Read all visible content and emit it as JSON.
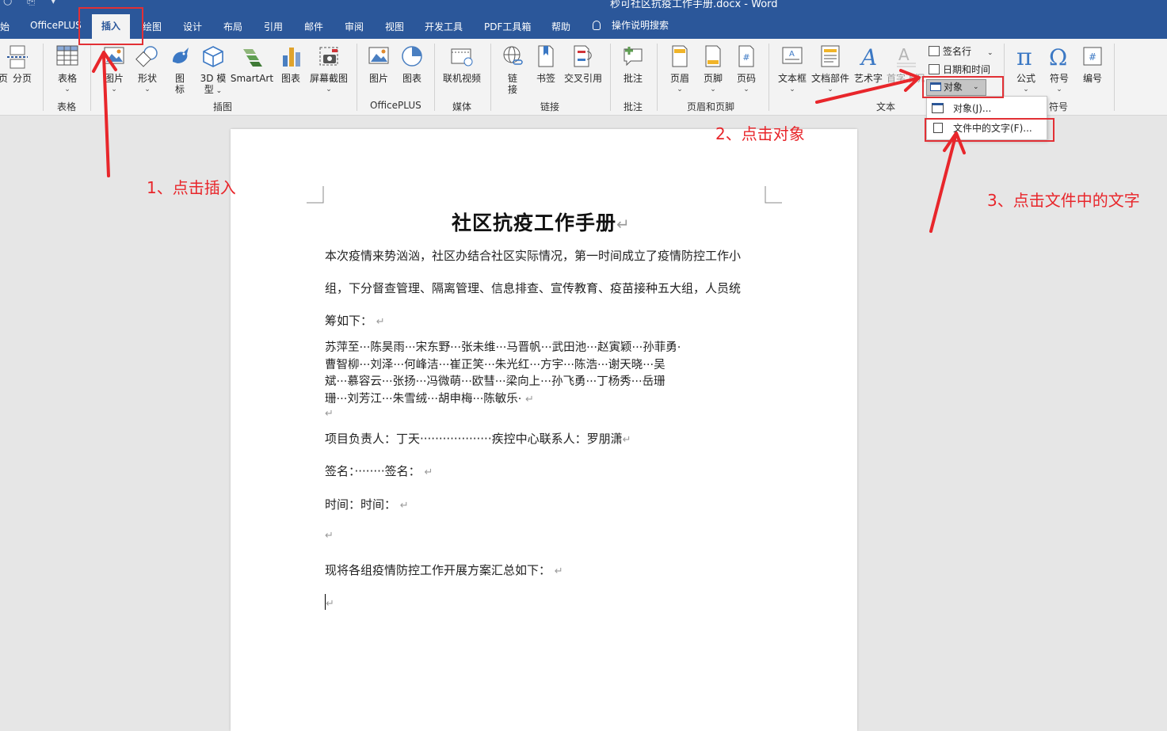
{
  "window": {
    "title": "秒可社区抗疫工作手册.docx  -  Word",
    "qa_icons": [
      "save-icon",
      "customize-quick-access-icon"
    ]
  },
  "tabs": [
    {
      "label": "始",
      "active": false
    },
    {
      "label": "OfficePLUS",
      "active": false
    },
    {
      "label": "插入",
      "active": true
    },
    {
      "label": "绘图",
      "active": false
    },
    {
      "label": "设计",
      "active": false
    },
    {
      "label": "布局",
      "active": false
    },
    {
      "label": "引用",
      "active": false
    },
    {
      "label": "邮件",
      "active": false
    },
    {
      "label": "审阅",
      "active": false
    },
    {
      "label": "视图",
      "active": false
    },
    {
      "label": "开发工具",
      "active": false
    },
    {
      "label": "PDF工具箱",
      "active": false
    },
    {
      "label": "帮助",
      "active": false
    }
  ],
  "tell_me": "操作说明搜索",
  "ribbon": {
    "buttons": {
      "page_break_prefix": "页",
      "page_break": "分页",
      "table": "表格",
      "picture": "图片",
      "shapes": "形状",
      "icons_l1": "图",
      "icons_l2": "标",
      "model3d_l1": "3D 模",
      "model3d_l2": "型",
      "smartart": "SmartArt",
      "chart": "图表",
      "screenshot": "屏幕截图",
      "op_picture": "图片",
      "op_chart": "图表",
      "online_video": "联机视频",
      "link_l1": "链",
      "link_l2": "接",
      "bookmark": "书签",
      "cross_ref": "交叉引用",
      "comment": "批注",
      "header": "页眉",
      "footer": "页脚",
      "page_number": "页码",
      "textbox": "文本框",
      "quick_parts": "文档部件",
      "wordart": "艺术字",
      "drop_cap": "首字下沉",
      "signature_line": "签名行",
      "date_time": "日期和时间",
      "object": "对象",
      "equation": "公式",
      "symbol": "符号",
      "number": "编号"
    },
    "groups": {
      "tables": "表格",
      "illustrations": "插图",
      "officeplus": "OfficePLUS",
      "media": "媒体",
      "links": "链接",
      "comments": "批注",
      "header_footer": "页眉和页脚",
      "text": "文本",
      "symbols": "符号"
    },
    "object_menu": {
      "item1": "对象(J)...",
      "item2": "文件中的文字(F)..."
    }
  },
  "document": {
    "title": "社区抗疫工作手册",
    "para1_l1": "本次疫情来势汹汹，社区办结合社区实际情况，第一时间成立了疫情防控工作小",
    "para1_l2": "组，下分督查管理、隔离管理、信息排查、宣传教育、疫苗接种五大组，人员统",
    "para1_l3": "筹如下：",
    "names_l1": "苏萍至···陈昊雨···宋东野···张未维···马晋帆···武田池···赵寅颖···孙菲勇·",
    "names_l2": "曹智柳···刘泽···何峰洁···崔正笑···朱光红···方宇···陈浩···谢天晓···吴",
    "names_l3": "斌···慕容云···张扬···冯微萌···欧彗···梁向上···孙飞勇···丁杨秀···岳珊",
    "names_l4": "珊···刘芳江···朱雪绒···胡申梅···陈敏乐·",
    "leader_line": "项目负责人：丁天···················疾控中心联系人：罗朋潇",
    "sign_line": "签名：········签名：",
    "time_line": "时间：时间：",
    "summary_line": "现将各组疫情防控工作开展方案汇总如下：",
    "para_mark": "↵"
  },
  "annotations": {
    "step1": "1、点击插入",
    "step2": "2、点击对象",
    "step3": "3、点击文件中的文字",
    "color": "#e8262b"
  },
  "colors": {
    "title_bar": "#2b579a",
    "ribbon_bg": "#f3f3f3",
    "workspace": "#e6e6e6",
    "annotation_red": "#e8262b"
  }
}
